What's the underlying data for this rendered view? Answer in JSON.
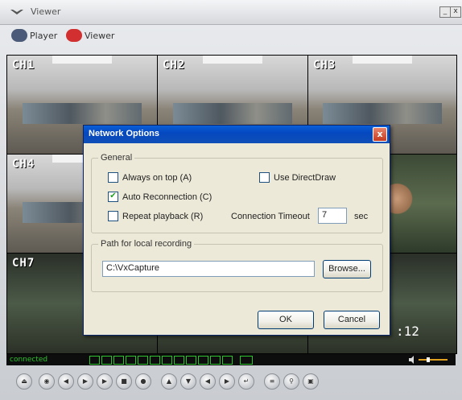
{
  "window": {
    "title": "Viewer",
    "min_label": "_",
    "close_label": "x"
  },
  "modes": [
    {
      "label": "Player"
    },
    {
      "label": "Viewer"
    }
  ],
  "channels": {
    "ch1": "CH1",
    "ch2": "CH2",
    "ch3": "CH3",
    "ch4": "CH4",
    "ch7": "CH7"
  },
  "overlay": {
    "timecode": ":12"
  },
  "status": {
    "text": "connected"
  },
  "dialog": {
    "title": "Network Options",
    "close_label": "x",
    "general": {
      "label": "General",
      "always_on_top": {
        "label": "Always on top (A)",
        "checked": false
      },
      "use_directdraw": {
        "label": "Use DirectDraw",
        "checked": false
      },
      "auto_reconnection": {
        "label": "Auto Reconnection (C)",
        "checked": true
      },
      "repeat_playback": {
        "label": "Repeat playback (R)",
        "checked": false
      },
      "timeout_label": "Connection Timeout",
      "timeout_value": "7",
      "timeout_unit": "sec"
    },
    "recording": {
      "label": "Path for local recording",
      "path": "C:\\VxCapture",
      "browse_label": "Browse..."
    },
    "ok_label": "OK",
    "cancel_label": "Cancel"
  },
  "colors": {
    "accent": "#0548c0",
    "status_green": "#2bc22b",
    "close_red": "#c63a1f"
  }
}
